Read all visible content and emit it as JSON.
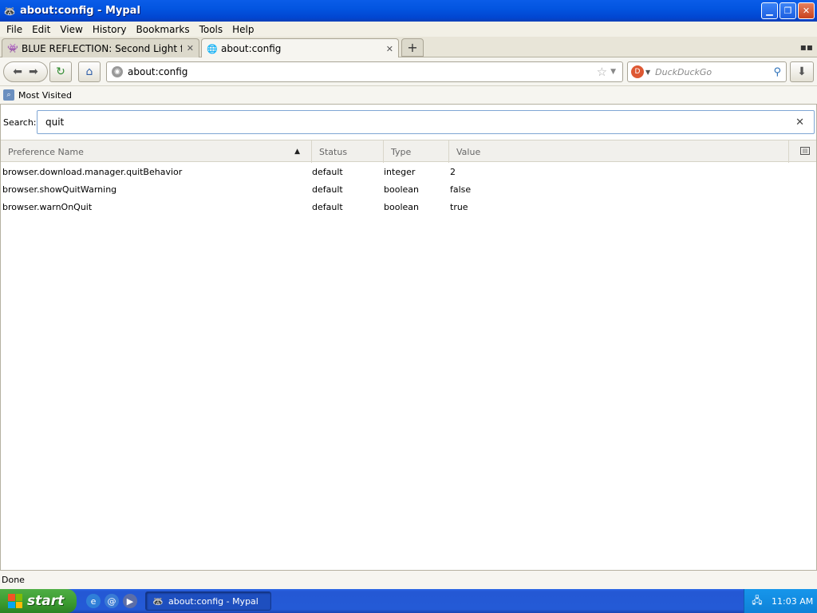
{
  "window": {
    "title": "about:config - Mypal",
    "icon": "mypal-raccoon-icon",
    "controls": [
      "minimize",
      "maximize",
      "close"
    ]
  },
  "menu": [
    "File",
    "Edit",
    "View",
    "History",
    "Bookmarks",
    "Tools",
    "Help"
  ],
  "tabs": [
    {
      "label": "BLUE REFLECTION: Second Light for Nint...",
      "icon": "pixel-character-icon",
      "active": false
    },
    {
      "label": "about:config",
      "icon": "globe-icon",
      "active": true
    }
  ],
  "navigation": {
    "url": "about:config",
    "search_placeholder": "DuckDuckGo",
    "search_engine_icon": "duckduckgo-icon"
  },
  "bookmarks": [
    {
      "label": "Most Visited",
      "icon": "most-visited-icon"
    }
  ],
  "config": {
    "search_label": "Search:",
    "search_value": "quit",
    "columns": [
      "Preference Name",
      "Status",
      "Type",
      "Value"
    ],
    "sorted_column": "Preference Name",
    "rows": [
      {
        "name": "browser.download.manager.quitBehavior",
        "status": "default",
        "type": "integer",
        "value": "2"
      },
      {
        "name": "browser.showQuitWarning",
        "status": "default",
        "type": "boolean",
        "value": "false"
      },
      {
        "name": "browser.warnOnQuit",
        "status": "default",
        "type": "boolean",
        "value": "true"
      }
    ]
  },
  "status": "Done",
  "taskbar": {
    "start_label": "start",
    "task_label": "about:config - Mypal",
    "clock": "11:03 AM",
    "colors": {
      "start": "#3a9a2f",
      "bar": "#245ad6",
      "tray": "#0e82d8"
    }
  }
}
